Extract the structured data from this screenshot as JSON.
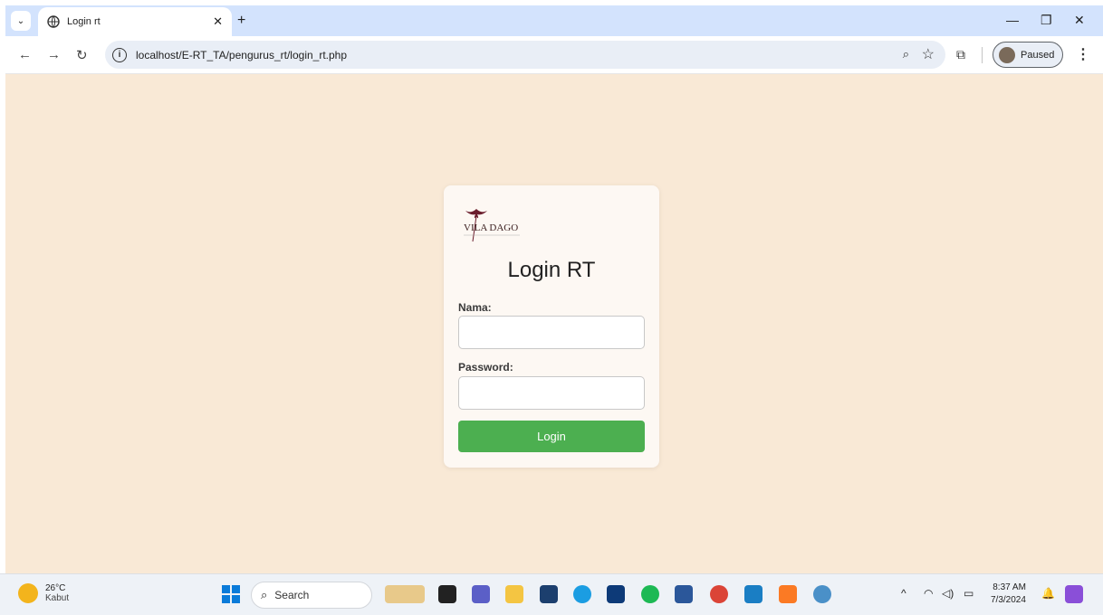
{
  "browser": {
    "tab_title": "Login rt",
    "url": "localhost/E-RT_TA/pengurus_rt/login_rt.php",
    "profile_label": "Paused"
  },
  "page": {
    "logo_text": "VILA DAGO",
    "title": "Login RT",
    "name_label": "Nama:",
    "name_value": "",
    "password_label": "Password:",
    "password_value": "",
    "login_button": "Login",
    "accent_color": "#4caf50",
    "background_color": "#f9e9d6"
  },
  "taskbar": {
    "weather_temp": "26°C",
    "weather_desc": "Kabut",
    "search_label": "Search",
    "time": "8:37 AM",
    "date": "7/3/2024"
  }
}
